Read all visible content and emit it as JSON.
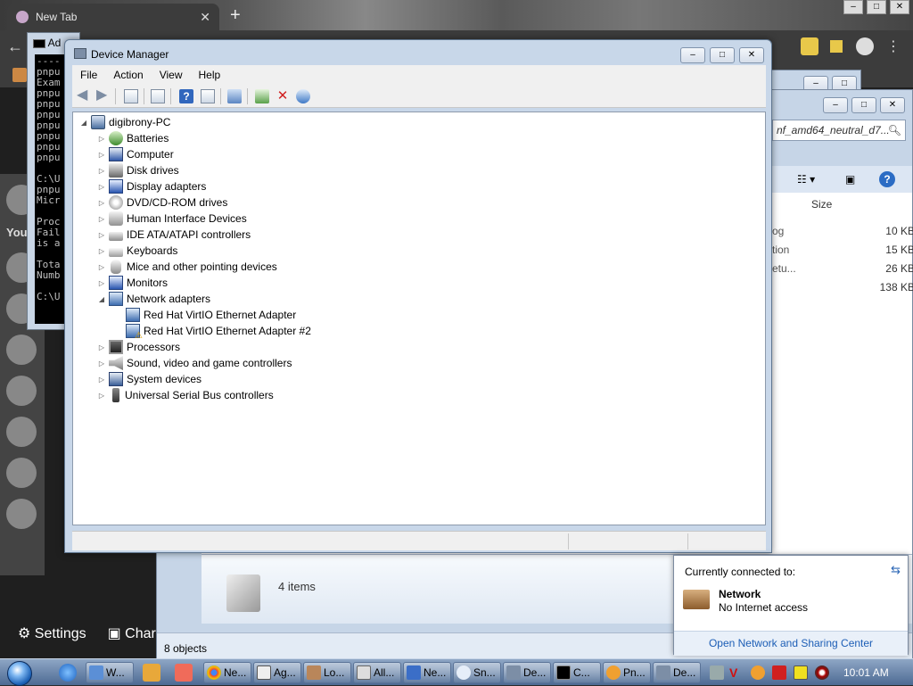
{
  "browser": {
    "tab_title": "New Tab",
    "bottom_links": [
      "Settings",
      "Char"
    ]
  },
  "cmd": {
    "title": "Ad",
    "lines": [
      "----",
      "pnpu",
      "Exam",
      "pnpu",
      "pnpu",
      "pnpu",
      "pnpu",
      "pnpu",
      "pnpu",
      "pnpu",
      "",
      "C:\\U",
      "pnpu",
      "Micr",
      "",
      "Proc",
      "Fail",
      "is a",
      "",
      "Tota",
      "Numb",
      "",
      "C:\\U"
    ]
  },
  "explorer": {
    "search_placeholder": "nf_amd64_neutral_d7...",
    "size_header": "Size",
    "files": [
      {
        "name": "og",
        "size": "10 KB"
      },
      {
        "name": "tion",
        "size": "15 KB"
      },
      {
        "name": "etu...",
        "size": "26 KB"
      },
      {
        "name": "",
        "size": "138 KB"
      }
    ],
    "items_count": "4 items",
    "status": "8 objects"
  },
  "device_manager": {
    "title": "Device Manager",
    "menu": [
      "File",
      "Action",
      "View",
      "Help"
    ],
    "root": "digibrony-PC",
    "categories": [
      {
        "label": "Batteries",
        "icon": "battery-icon"
      },
      {
        "label": "Computer",
        "icon": "computer-icon"
      },
      {
        "label": "Disk drives",
        "icon": "disk-drive-icon"
      },
      {
        "label": "Display adapters",
        "icon": "display-adapter-icon"
      },
      {
        "label": "DVD/CD-ROM drives",
        "icon": "dvd-drive-icon"
      },
      {
        "label": "Human Interface Devices",
        "icon": "hid-icon"
      },
      {
        "label": "IDE ATA/ATAPI controllers",
        "icon": "ide-controller-icon"
      },
      {
        "label": "Keyboards",
        "icon": "keyboard-icon"
      },
      {
        "label": "Mice and other pointing devices",
        "icon": "mouse-icon"
      },
      {
        "label": "Monitors",
        "icon": "monitor-icon"
      },
      {
        "label": "Network adapters",
        "icon": "network-adapter-icon"
      },
      {
        "label": "Processors",
        "icon": "processor-icon"
      },
      {
        "label": "Sound, video and game controllers",
        "icon": "sound-icon"
      },
      {
        "label": "System devices",
        "icon": "system-device-icon"
      },
      {
        "label": "Universal Serial Bus controllers",
        "icon": "usb-icon"
      }
    ],
    "network_children": [
      "Red Hat VirtIO Ethernet Adapter",
      "Red Hat VirtIO Ethernet Adapter #2"
    ]
  },
  "network_flyout": {
    "title": "Currently connected to:",
    "network_name": "Network",
    "status": "No Internet access",
    "link": "Open Network and Sharing Center"
  },
  "taskbar": {
    "tasks": [
      "W...",
      "Ne...",
      "Ag...",
      "Lo...",
      "All...",
      "Ne...",
      "Sn...",
      "De...",
      "C...",
      "Pn...",
      "De..."
    ],
    "clock": "10:01 AM"
  }
}
